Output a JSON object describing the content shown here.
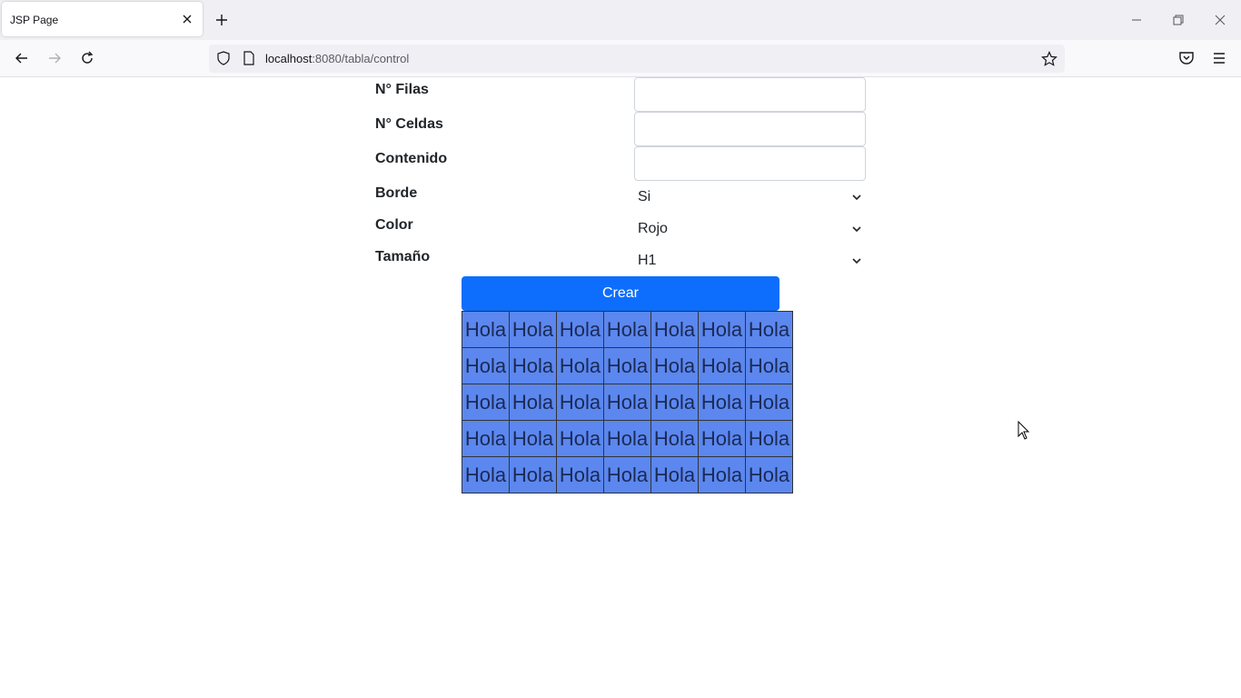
{
  "browser": {
    "tab_title": "JSP Page",
    "url_host": "localhost",
    "url_path": ":8080/tabla/control"
  },
  "form": {
    "filas_label": "N° Filas",
    "celdas_label": "N° Celdas",
    "contenido_label": "Contenido",
    "borde_label": "Borde",
    "borde_value": "Si",
    "color_label": "Color",
    "color_value": "Rojo",
    "tamano_label": "Tamaño",
    "tamano_value": "H1",
    "submit_label": "Crear"
  },
  "table": {
    "rows": [
      [
        "Hola",
        "Hola",
        "Hola",
        "Hola",
        "Hola",
        "Hola",
        "Hola"
      ],
      [
        "Hola",
        "Hola",
        "Hola",
        "Hola",
        "Hola",
        "Hola",
        "Hola"
      ],
      [
        "Hola",
        "Hola",
        "Hola",
        "Hola",
        "Hola",
        "Hola",
        "Hola"
      ],
      [
        "Hola",
        "Hola",
        "Hola",
        "Hola",
        "Hola",
        "Hola",
        "Hola"
      ],
      [
        "Hola",
        "Hola",
        "Hola",
        "Hola",
        "Hola",
        "Hola",
        "Hola"
      ]
    ],
    "cell_color": "#5b87ef"
  },
  "colors": {
    "button": "#0d6efd"
  }
}
